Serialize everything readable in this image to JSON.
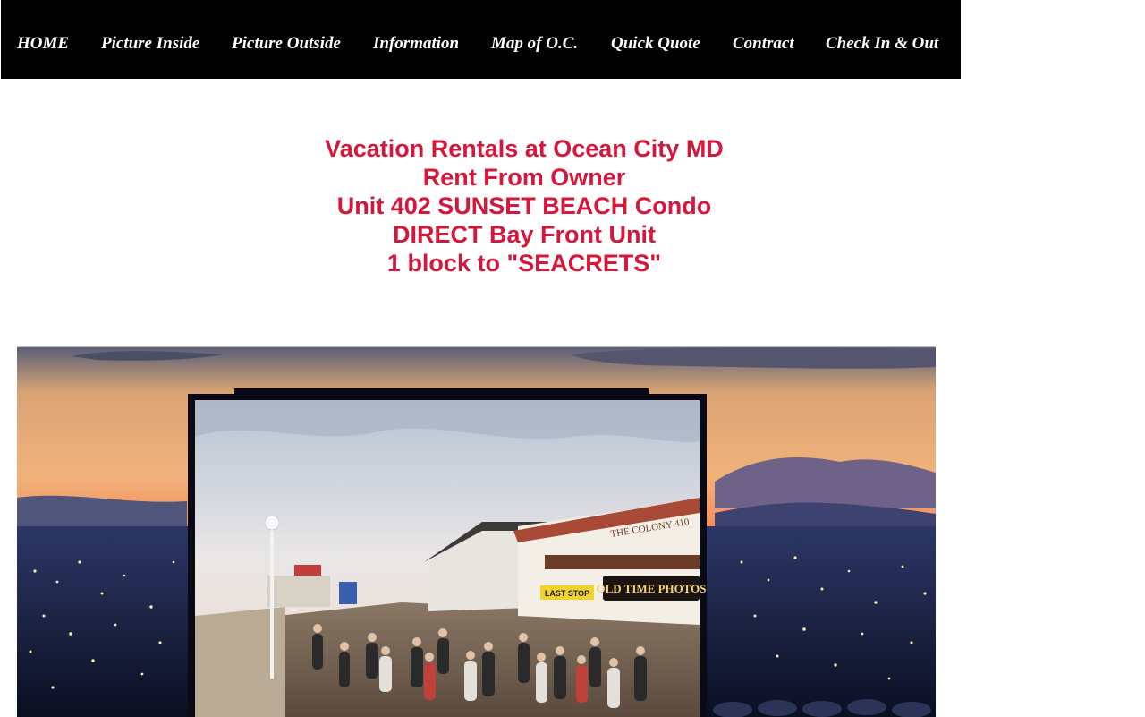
{
  "nav": {
    "items": [
      {
        "label": "HOME"
      },
      {
        "label": "Picture Inside"
      },
      {
        "label": "Picture Outside"
      },
      {
        "label": "Information"
      },
      {
        "label": "Map of O.C."
      },
      {
        "label": "Quick Quote"
      },
      {
        "label": "Contract"
      },
      {
        "label": "Check In & Out"
      }
    ]
  },
  "headline": {
    "lines": [
      "Vacation Rentals at Ocean City MD",
      "Rent From Owner",
      "Unit 402 SUNSET BEACH Condo",
      "DIRECT Bay Front Unit",
      "1 block to \"SEACRETS\""
    ],
    "color": "#d4173b"
  },
  "hero": {
    "signs": {
      "colony": "THE COLONY 410",
      "old_time_photos": "OLD TIME PHOTOS",
      "last_stop": "LAST STOP"
    }
  }
}
